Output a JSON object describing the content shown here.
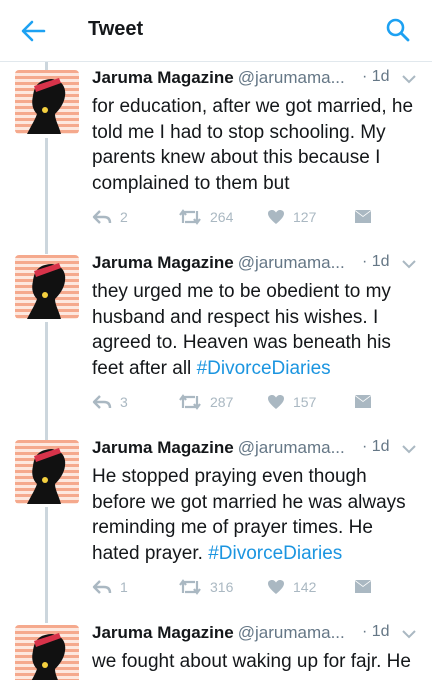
{
  "header": {
    "title": "Tweet",
    "back_icon": "arrow-left-icon",
    "search_icon": "search-icon",
    "accent": "#1da1f2"
  },
  "colors": {
    "hashtag": "#1b95e0",
    "muted": "#657786",
    "action": "#aab8c2",
    "avatar_stripe": "#f5a98d"
  },
  "tweets": [
    {
      "name": "Jaruma Magazine",
      "handle": "@jarumama...",
      "time": "· 1d",
      "text": "for education, after we got married, he told me I had to stop schooling. My parents knew about this because I complained to them but",
      "hashtag": "",
      "replies": "2",
      "retweets": "264",
      "likes": "127"
    },
    {
      "name": "Jaruma Magazine",
      "handle": "@jarumama...",
      "time": "· 1d",
      "text": "they urged me to be obedient to my husband and respect his wishes. I agreed to. Heaven was beneath his feet after all ",
      "hashtag": "#DivorceDiaries",
      "replies": "3",
      "retweets": "287",
      "likes": "157"
    },
    {
      "name": "Jaruma Magazine",
      "handle": "@jarumama...",
      "time": "· 1d",
      "text": "He stopped praying even though before we got married he was always reminding me of prayer times. He hated prayer. ",
      "hashtag": "#DivorceDiaries",
      "replies": "1",
      "retweets": "316",
      "likes": "142"
    },
    {
      "name": "Jaruma Magazine",
      "handle": "@jarumama...",
      "time": "· 1d",
      "text": "we fought about waking up for fajr. He",
      "hashtag": ""
    }
  ]
}
